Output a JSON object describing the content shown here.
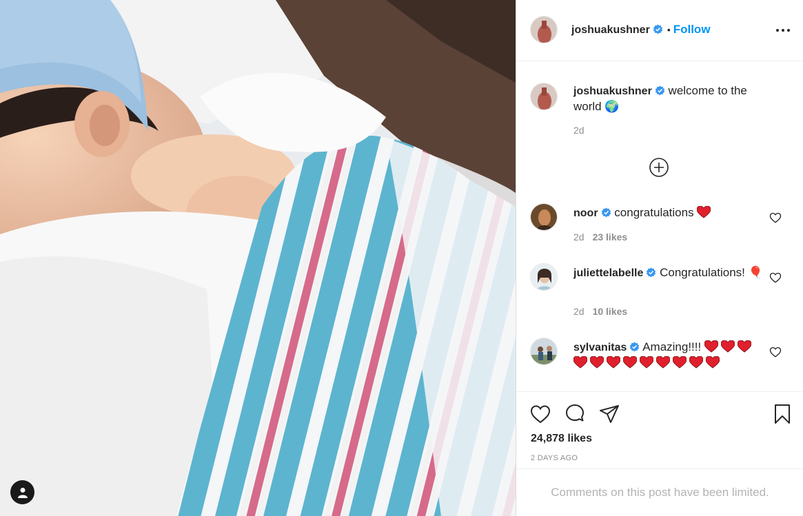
{
  "post": {
    "author": "joshuakushner",
    "follow_label": "Follow",
    "dot": "•",
    "caption_text": "welcome to the world 🌍",
    "caption_time": "2d",
    "likes_count": "24,878 likes",
    "time_ago": "2 DAYS AGO",
    "comments_limited": "Comments on this post have been limited."
  },
  "comments": [
    {
      "user": "noor",
      "text": "congratulations",
      "time": "2d",
      "likes": "23 likes"
    },
    {
      "user": "juliettelabelle",
      "text": "Congratulations! 🎈",
      "time": "2d",
      "likes": "10 likes"
    },
    {
      "user": "sylvanitas",
      "text": "Amazing!!!!"
    }
  ],
  "colors": {
    "accent": "#0095f6",
    "verified": "#3897f0",
    "heart_emoji": "#e0202d",
    "muted": "#8e8e8e"
  },
  "icons": [
    "more-icon",
    "verified-badge-icon",
    "add-comment-icon",
    "like-icon",
    "comment-icon",
    "share-icon",
    "save-icon",
    "heart-small-icon",
    "user-tag-icon"
  ]
}
